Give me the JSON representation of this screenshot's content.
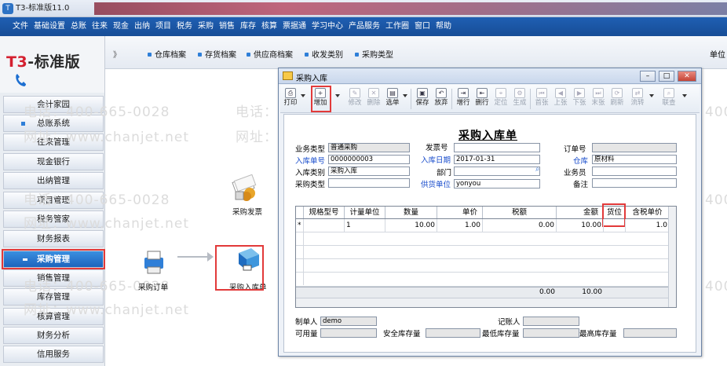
{
  "app": {
    "title": "T3-标准版11.0",
    "icon_letter": "T"
  },
  "menu": [
    "文件",
    "基础设置",
    "总账",
    "往来",
    "现金",
    "出纳",
    "项目",
    "税务",
    "采购",
    "销售",
    "库存",
    "核算",
    "票据通",
    "学习中心",
    "产品服务",
    "工作圈",
    "窗口",
    "帮助"
  ],
  "logo": {
    "prefix": "T3",
    "dash": "-",
    "suffix": "标准版"
  },
  "quickbar": {
    "chevron": "》",
    "items": [
      "仓库档案",
      "存货档案",
      "供应商档案",
      "收发类别",
      "采购类型"
    ],
    "unit_label": "单位"
  },
  "sidebar": {
    "items": [
      "会计家园",
      "总账系统",
      "往来管理",
      "现金银行",
      "出纳管理",
      "项目管理",
      "税务管家",
      "财务报表",
      "采购管理",
      "销售管理",
      "库存管理",
      "核算管理",
      "财务分析",
      "信用服务"
    ],
    "active": "采购管理"
  },
  "watermarks": {
    "phone": "电话：400-665-0028",
    "site": "网址：www.chanjet.net"
  },
  "flow": {
    "invoice": "采购发票",
    "order": "采购订单",
    "receipt": "采购入库单"
  },
  "window": {
    "title": "采购入库",
    "controls": {
      "min": "–",
      "max": "□",
      "close": "✕"
    },
    "toolbar": [
      "打印",
      "增加",
      "修改",
      "删除",
      "选单",
      "保存",
      "放弃",
      "增行",
      "删行",
      "定位",
      "生成",
      "首张",
      "上张",
      "下张",
      "末张",
      "刷新",
      "流转",
      "联查"
    ],
    "doc_title": "采购入库单",
    "fields": {
      "biz_type": {
        "label": "业务类型",
        "value": "普通采购"
      },
      "invoice_no": {
        "label": "发票号",
        "value": ""
      },
      "order_no": {
        "label": "订单号",
        "value": ""
      },
      "in_no": {
        "label": "入库单号",
        "value": "0000000003"
      },
      "in_date": {
        "label": "入库日期",
        "value": "2017-01-31"
      },
      "warehouse": {
        "label": "仓库",
        "value": "原材料"
      },
      "in_type": {
        "label": "入库类别",
        "value": "采购入库"
      },
      "dept": {
        "label": "部门",
        "value": ""
      },
      "clerk": {
        "label": "业务员",
        "value": ""
      },
      "purchase_type": {
        "label": "采购类型",
        "value": ""
      },
      "supplier": {
        "label": "供货单位",
        "value": "yonyou"
      },
      "remark": {
        "label": "备注",
        "value": ""
      }
    },
    "grid": {
      "headers": [
        "规格型号",
        "计量单位",
        "数量",
        "单价",
        "税额",
        "金额",
        "货位",
        "含税单价"
      ],
      "rows": [
        {
          "marker": "*",
          "spec": "",
          "unit": "1",
          "qty": "10.00",
          "price": "1.00",
          "tax": "0.00",
          "amount": "10.00",
          "loc": "",
          "tax_price": "1.0"
        }
      ],
      "sum": {
        "tax": "0.00",
        "amount": "10.00"
      }
    },
    "footer": {
      "maker_label": "制单人",
      "maker_value": "demo",
      "booker_label": "记账人",
      "booker_value": "",
      "avail_label": "可用量",
      "safe_label": "安全库存量",
      "min_label": "最低库存量",
      "max_label": "最高库存量"
    }
  },
  "colors": {
    "menubar": "#1f5fb3",
    "highlight": "#e23a3a",
    "label_blue": "#1a4dcc"
  }
}
